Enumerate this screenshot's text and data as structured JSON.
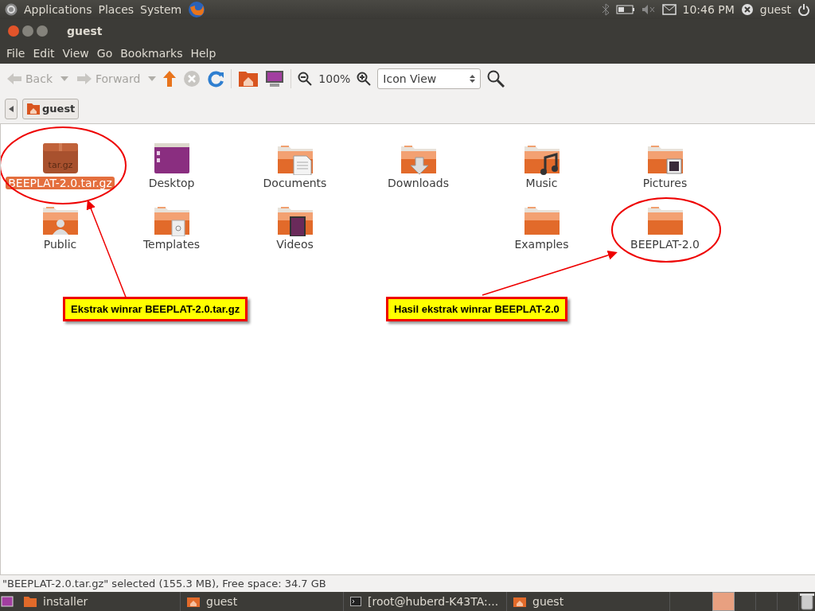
{
  "top_panel": {
    "menus": [
      "Applications",
      "Places",
      "System"
    ],
    "clock": "10:46 PM",
    "user": "guest"
  },
  "window": {
    "title": "guest"
  },
  "menu_bar": [
    "File",
    "Edit",
    "View",
    "Go",
    "Bookmarks",
    "Help"
  ],
  "toolbar": {
    "back": {
      "label": "Back",
      "disabled": true
    },
    "forward": {
      "label": "Forward",
      "disabled": true
    },
    "zoom": "100%",
    "view_mode": "Icon View"
  },
  "path_bar": {
    "current": "guest"
  },
  "files": [
    {
      "left": [
        {
          "name": "BEEPLAT-2.0.tar.gz",
          "kind": "archive",
          "badge": "tar.gz",
          "selected": true
        },
        {
          "name": "Desktop",
          "kind": "desktop",
          "selected": false
        },
        {
          "name": "Documents",
          "kind": "documents",
          "selected": false
        },
        {
          "name": "Downloads",
          "kind": "downloads",
          "selected": false
        },
        {
          "name": "Music",
          "kind": "music",
          "selected": false
        },
        {
          "name": "Pictures",
          "kind": "pictures",
          "selected": false
        }
      ]
    },
    {
      "left": [
        {
          "name": "Public",
          "kind": "public",
          "selected": false
        },
        {
          "name": "Templates",
          "kind": "templates",
          "selected": false
        },
        {
          "name": "Videos",
          "kind": "videos",
          "selected": false
        }
      ],
      "right": [
        {
          "name": "Examples",
          "kind": "folder",
          "selected": false
        },
        {
          "name": "BEEPLAT-2.0",
          "kind": "folder",
          "selected": false
        }
      ]
    }
  ],
  "annotations": [
    {
      "text": "Ekstrak winrar BEEPLAT-2.0.tar.gz"
    },
    {
      "text": "Hasil ekstrak winrar BEEPLAT-2.0"
    }
  ],
  "status_bar": "\"BEEPLAT-2.0.tar.gz\" selected (155.3 MB), Free space: 34.7 GB",
  "taskbar": [
    {
      "label": "installer",
      "kind": "folder"
    },
    {
      "label": "guest",
      "kind": "home"
    },
    {
      "label": "[root@huberd-K43TA:...",
      "kind": "terminal"
    },
    {
      "label": "guest",
      "kind": "home"
    }
  ]
}
